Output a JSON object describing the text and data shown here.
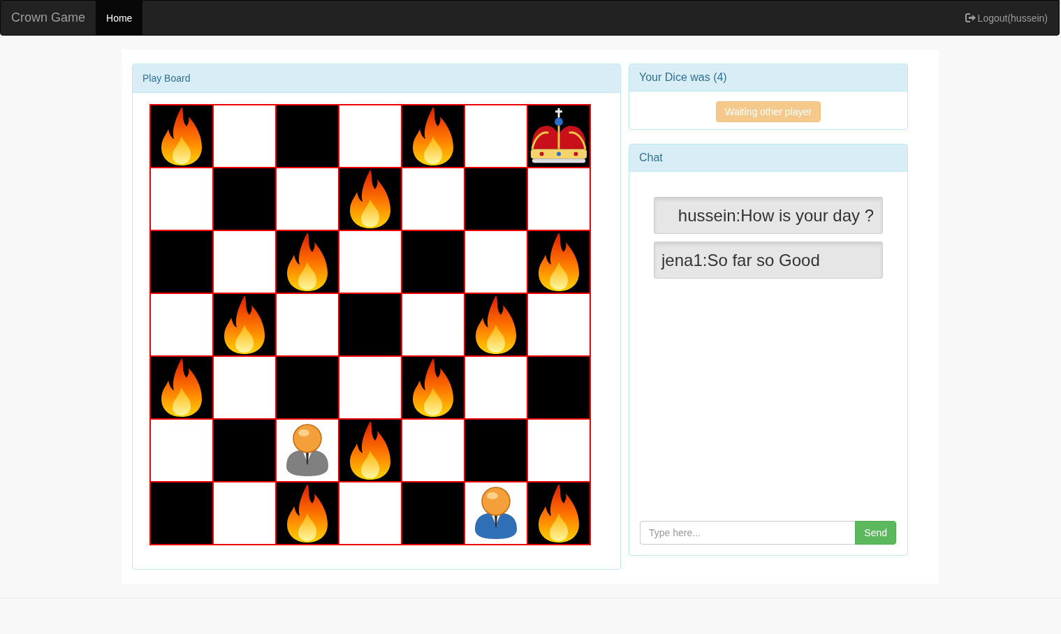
{
  "navbar": {
    "brand": "Crown Game",
    "nav_items": [
      {
        "label": "Home",
        "selected": true
      }
    ],
    "logout": "Logout(hussein)"
  },
  "play_board": {
    "title": "Play Board",
    "rows": [
      [
        {
          "kind": "fire"
        },
        {
          "kind": "empty"
        },
        {
          "kind": "empty"
        },
        {
          "kind": "empty"
        },
        {
          "kind": "fire"
        },
        {
          "kind": "empty"
        },
        {
          "kind": "crown"
        }
      ],
      [
        {
          "kind": "empty"
        },
        {
          "kind": "empty"
        },
        {
          "kind": "empty"
        },
        {
          "kind": "fire"
        },
        {
          "kind": "empty"
        },
        {
          "kind": "empty"
        },
        {
          "kind": "empty"
        }
      ],
      [
        {
          "kind": "empty"
        },
        {
          "kind": "empty"
        },
        {
          "kind": "fire"
        },
        {
          "kind": "empty"
        },
        {
          "kind": "empty"
        },
        {
          "kind": "empty"
        },
        {
          "kind": "fire"
        }
      ],
      [
        {
          "kind": "empty"
        },
        {
          "kind": "fire"
        },
        {
          "kind": "empty"
        },
        {
          "kind": "empty"
        },
        {
          "kind": "empty"
        },
        {
          "kind": "fire"
        },
        {
          "kind": "empty"
        }
      ],
      [
        {
          "kind": "fire"
        },
        {
          "kind": "empty"
        },
        {
          "kind": "empty"
        },
        {
          "kind": "empty"
        },
        {
          "kind": "fire"
        },
        {
          "kind": "empty"
        },
        {
          "kind": "empty"
        }
      ],
      [
        {
          "kind": "empty"
        },
        {
          "kind": "empty"
        },
        {
          "kind": "player",
          "color": "#808080"
        },
        {
          "kind": "fire"
        },
        {
          "kind": "empty"
        },
        {
          "kind": "empty"
        },
        {
          "kind": "empty"
        }
      ],
      [
        {
          "kind": "empty"
        },
        {
          "kind": "empty"
        },
        {
          "kind": "fire"
        },
        {
          "kind": "empty"
        },
        {
          "kind": "empty"
        },
        {
          "kind": "player",
          "color": "#2f6fb5"
        },
        {
          "kind": "fire"
        }
      ]
    ]
  },
  "dice": {
    "title": "Your Dice was (4)",
    "button": {
      "label": "Waiting other player",
      "disabled": true
    }
  },
  "chat": {
    "title": "Chat",
    "messages": [
      {
        "text": "hussein:How is your day ?",
        "mine": true
      },
      {
        "text": "jena1:So far so Good",
        "mine": false
      }
    ],
    "input": {
      "placeholder": "Type here..."
    },
    "send": "Send"
  }
}
